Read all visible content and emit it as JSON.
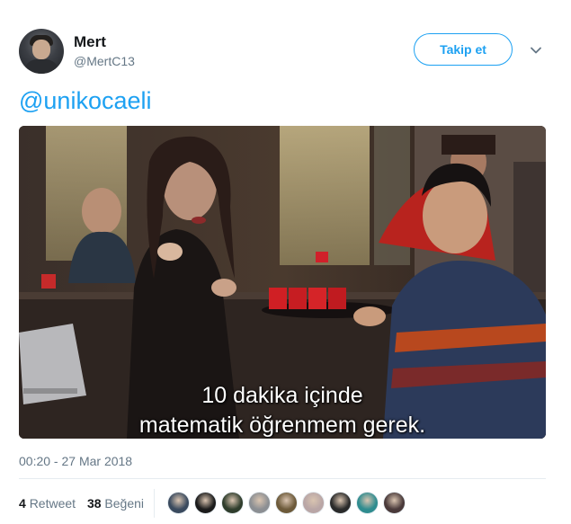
{
  "user": {
    "name": "Mert",
    "handle": "@MertC13",
    "follow_label": "Takip et"
  },
  "tweet": {
    "text": "@unikocaeli",
    "media": {
      "subtitle_line1": "10 dakika içinde",
      "subtitle_line2": "matematik öğrenmem gerek."
    },
    "timestamp": "00:20 - 27 Mar 2018"
  },
  "stats": {
    "retweets_count": "4",
    "retweets_label": "Retweet",
    "likes_count": "38",
    "likes_label": "Beğeni"
  },
  "likers": [
    {
      "color": "#3a4a5e"
    },
    {
      "color": "#1b1b1b"
    },
    {
      "color": "#2f3d2c"
    },
    {
      "color": "#8c8f93"
    },
    {
      "color": "#6d5a3a"
    },
    {
      "color": "#b9a6a6"
    },
    {
      "color": "#2a2a2a"
    },
    {
      "color": "#2f8c8f"
    },
    {
      "color": "#4a3a3a"
    }
  ],
  "colors": {
    "accent": "#1da1f2",
    "secondary_text": "#657786"
  }
}
